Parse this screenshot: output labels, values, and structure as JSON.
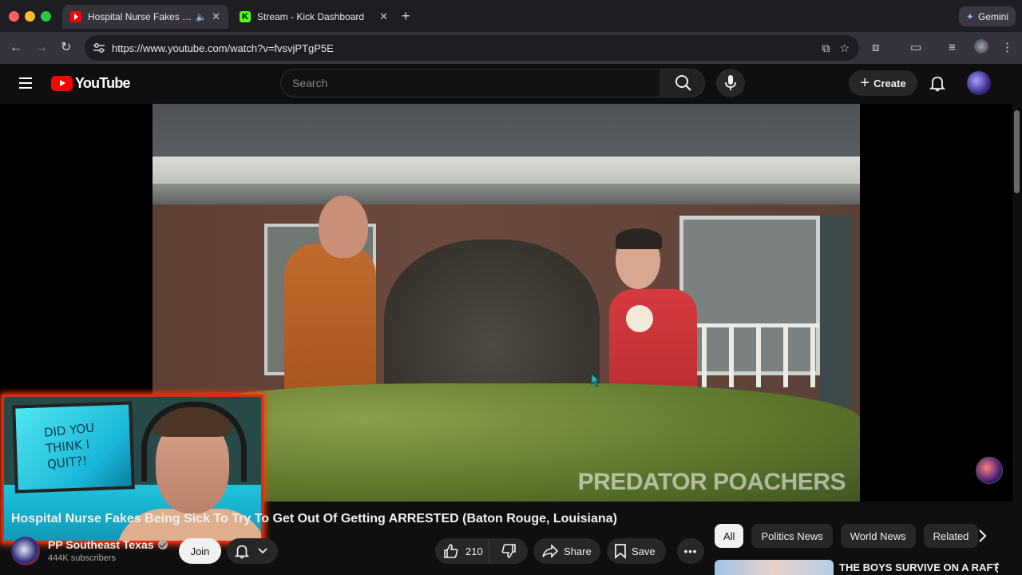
{
  "browser": {
    "tabs": [
      {
        "title": "Hospital Nurse Fakes Being Sick To Try To Get Out Of Getting ARRESTED",
        "active": true,
        "favicon": "youtube-icon"
      },
      {
        "title": "Stream - Kick Dashboard",
        "active": false,
        "favicon": "kick-icon"
      }
    ],
    "gemini_label": "Gemini",
    "url": "https://www.youtube.com/watch?v=fvsvjPTgP5E"
  },
  "youtube": {
    "logo_text": "YouTube",
    "search_placeholder": "Search",
    "create_label": "Create"
  },
  "video": {
    "watermark": "PREDATOR POACHERS",
    "webcam_board_text": "DID YOU THINK I QUIT?!",
    "title": "Hospital Nurse Fakes Being Sick To Try To Get Out Of Getting ARRESTED (Baton Rouge, Louisiana)"
  },
  "channel": {
    "name": "PP Southeast Texas",
    "subscribers": "444K subscribers",
    "join_label": "Join"
  },
  "actions": {
    "likes": "210",
    "share_label": "Share",
    "save_label": "Save",
    "more_label": "•••"
  },
  "chips": [
    "All",
    "Politics News",
    "World News",
    "Related"
  ],
  "recommendation": {
    "title": "THE BOYS SURVIVE ON A RAFT"
  },
  "colors": {
    "youtube_red": "#ff0000",
    "webcam_border": "#e02a10",
    "kick_green": "#53fc18"
  }
}
